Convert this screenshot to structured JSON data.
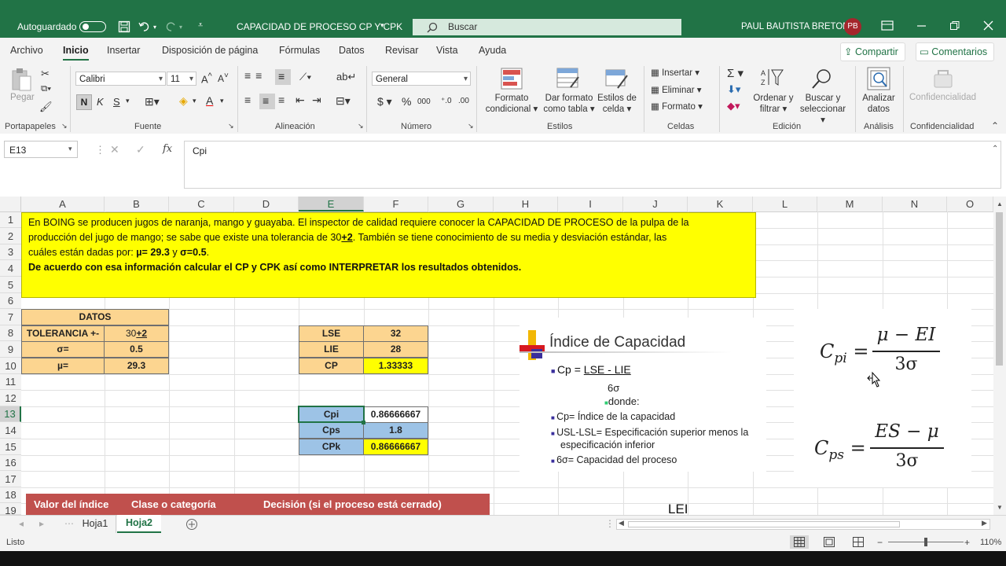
{
  "titlebar": {
    "autosave_label": "Autoguardado",
    "doc_title": "CAPACIDAD DE PROCESO CP Y CPK",
    "search_placeholder": "Buscar",
    "user_name": "PAUL BAUTISTA BRETON",
    "user_initials": "PB"
  },
  "menu": {
    "tabs": [
      "Archivo",
      "Inicio",
      "Insertar",
      "Disposición de página",
      "Fórmulas",
      "Datos",
      "Revisar",
      "Vista",
      "Ayuda"
    ],
    "share": "Compartir",
    "comments": "Comentarios"
  },
  "ribbon": {
    "paste": "Pegar",
    "font_name": "Calibri",
    "font_size": "11",
    "bold": "N",
    "italic": "K",
    "underline": "S",
    "number_format": "General",
    "cond_format": [
      "Formato",
      "condicional"
    ],
    "table_format": [
      "Dar formato",
      "como tabla"
    ],
    "cell_styles": [
      "Estilos de",
      "celda"
    ],
    "insert": "Insertar",
    "delete": "Eliminar",
    "format": "Formato",
    "sort_filter": [
      "Ordenar y",
      "filtrar"
    ],
    "find_select": [
      "Buscar y",
      "seleccionar"
    ],
    "analyze": [
      "Analizar",
      "datos"
    ],
    "confidential": "Confidencialidad",
    "groups": [
      "Portapapeles",
      "Fuente",
      "Alineación",
      "Número",
      "Estilos",
      "Celdas",
      "Edición",
      "Análisis",
      "Confidencialidad"
    ]
  },
  "formula_bar": {
    "name_box": "E13",
    "content": "Cpi"
  },
  "columns": [
    "A",
    "B",
    "C",
    "D",
    "E",
    "F",
    "G",
    "H",
    "I",
    "J",
    "K",
    "L",
    "M",
    "N",
    "O"
  ],
  "rows": [
    "1",
    "2",
    "3",
    "4",
    "5",
    "6",
    "7",
    "8",
    "9",
    "10",
    "11",
    "12",
    "13",
    "14",
    "15",
    "16",
    "17",
    "18",
    "19"
  ],
  "problem": {
    "line1": "En BOING  se producen jugos de naranja, mango y guayaba. El inspector de calidad requiere conocer la CAPACIDAD DE PROCESO  de la pulpa de la",
    "line2a": "producción del jugo de mango; se sabe que existe una tolerancia de 30",
    "line2b": "+2",
    "line2c": ". También se tiene conocimiento de su media y desviación estándar, las",
    "line3a": "cuáles están dadas por: ",
    "line3b": "µ= 29.3",
    "line3c": " y ",
    "line3d": "σ=0.5",
    "line3e": ".",
    "line4": "De acuerdo con esa información calcular el CP y CPK así como INTERPRETAR  los resultados obtenidos."
  },
  "datos": {
    "header": "DATOS",
    "rows": [
      {
        "label": "TOLERANCIA +-",
        "value_a": "30",
        "value_b": "+2"
      },
      {
        "label": "σ=",
        "value": "0.5"
      },
      {
        "label": "µ=",
        "value": "29.3"
      }
    ]
  },
  "spec": {
    "rows": [
      {
        "label": "LSE",
        "value": "32"
      },
      {
        "label": "LIE",
        "value": "28"
      },
      {
        "label": "CP",
        "value": "1.33333"
      }
    ]
  },
  "capability": {
    "rows": [
      {
        "label": "Cpi",
        "value": "0.86666667"
      },
      {
        "label": "Cps",
        "value": "1.8"
      },
      {
        "label": "CPk",
        "value": "0.86666667"
      }
    ]
  },
  "slide": {
    "title": "Índice de Capacidad",
    "formula_lhs": "Cp = ",
    "formula_num": "LSE - LIE",
    "formula_den": "6σ",
    "donde": "donde:",
    "bullets": [
      "Cp= Índice de la capacidad",
      "USL-LSL= Especificación superior menos la",
      "especificación inferior",
      "6σ= Capacidad del proceso"
    ]
  },
  "formulas": {
    "cpi_lhs": "C",
    "cpi_sub": "pi",
    "cpi_num": "μ − EI",
    "cpi_den": "3σ",
    "cps_lhs": "C",
    "cps_sub": "ps",
    "cps_num": "ES − μ",
    "cps_den": "3σ"
  },
  "lei_label": "LEI",
  "table_header": {
    "c1": "Valor del índice",
    "c2": "Clase o categoría",
    "c3": "Decisión (si el proceso está cerrado)"
  },
  "sheets": [
    "Hoja1",
    "Hoja2"
  ],
  "status": {
    "mode": "Listo",
    "zoom": "110%"
  },
  "colors": {
    "excel_green": "#217346",
    "yellow": "#ffff00",
    "tan": "#fcd590",
    "blue_cell": "#9dc3e6",
    "red_header": "#c0504d"
  }
}
